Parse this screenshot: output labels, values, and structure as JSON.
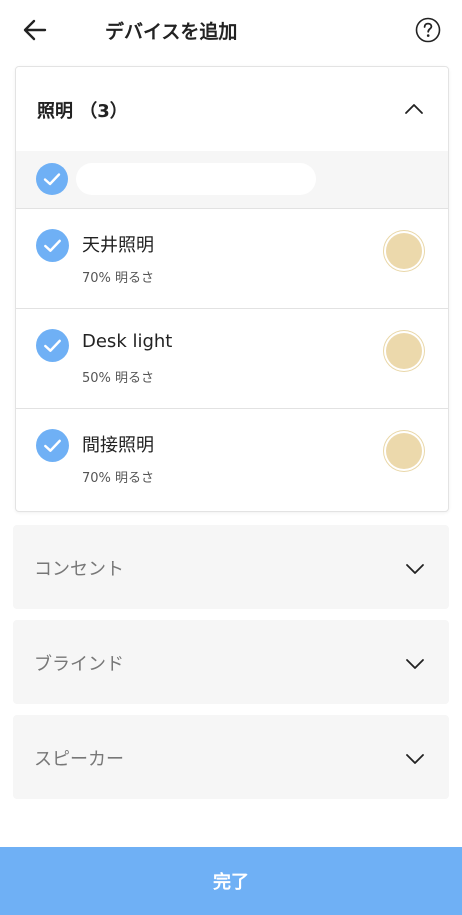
{
  "header": {
    "title": "デバイスを追加",
    "back_icon": "arrow-left-icon",
    "help_icon": "question-circle-icon"
  },
  "lighting": {
    "title": "照明 （3）",
    "expanded": true,
    "devices": [
      {
        "name": "天井照明",
        "status": "70% 明るさ",
        "checked": true
      },
      {
        "name": "Desk light",
        "status": "50% 明るさ",
        "checked": true
      },
      {
        "name": "間接照明",
        "status": "70% 明るさ",
        "checked": true
      }
    ]
  },
  "categories": [
    {
      "label": "コンセント"
    },
    {
      "label": "ブラインド"
    },
    {
      "label": "スピーカー"
    }
  ],
  "done_label": "完了",
  "colors": {
    "accent": "#6fb0f5",
    "bulb": "#ecd9ac",
    "panel_bg": "#f6f6f6"
  }
}
